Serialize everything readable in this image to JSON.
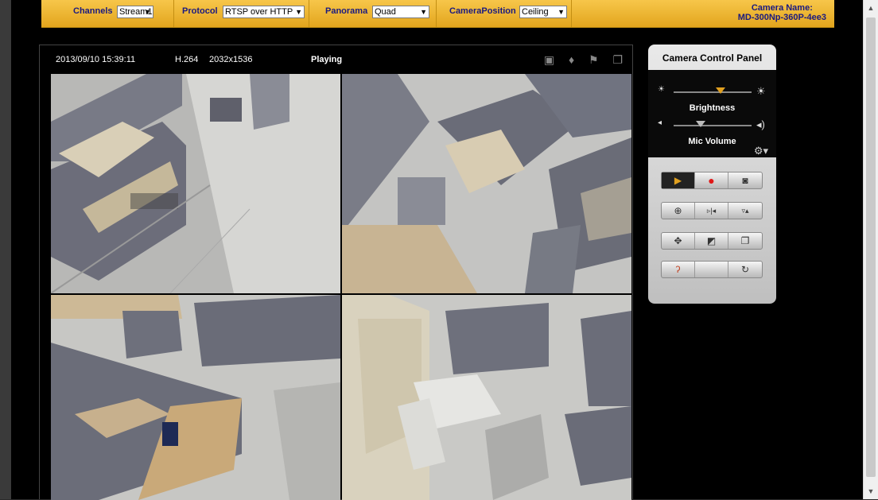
{
  "toolbar": {
    "channels_label": "Channels",
    "channels_value": "Stream1",
    "protocol_label": "Protocol",
    "protocol_value": "RTSP over HTTP",
    "panorama_label": "Panorama",
    "panorama_value": "Quad",
    "camera_position_label": "CameraPosition",
    "camera_position_value": "Ceiling",
    "camera_name_label": "Camera Name:",
    "camera_name_value": "MD-300Np-360P-4ee3"
  },
  "status": {
    "timestamp": "2013/09/10  15:39:11",
    "codec": "H.264",
    "resolution": "2032x1536",
    "state": "Playing"
  },
  "status_icons": [
    "video-camera-icon",
    "microphone-icon",
    "flag-icon",
    "window-icon"
  ],
  "control_panel": {
    "title": "Camera Control Panel",
    "brightness_label": "Brightness",
    "brightness_level": 0.6,
    "mic_volume_label": "Mic Volume",
    "mic_volume_level": 0.35,
    "button_icons": [
      [
        "play-icon",
        "record-icon",
        "snapshot-icon"
      ],
      [
        "zoom-icon",
        "flip-horizontal-icon",
        "flip-vertical-icon"
      ],
      [
        "move-icon",
        "crop-icon",
        "window-icon"
      ],
      [
        "listen-icon",
        "blank",
        "rotate-icon"
      ]
    ]
  },
  "colors": {
    "toolbar": "#e8b030",
    "accent": "#e0a020",
    "record": "#e01818",
    "label_text": "#1a1a80"
  }
}
